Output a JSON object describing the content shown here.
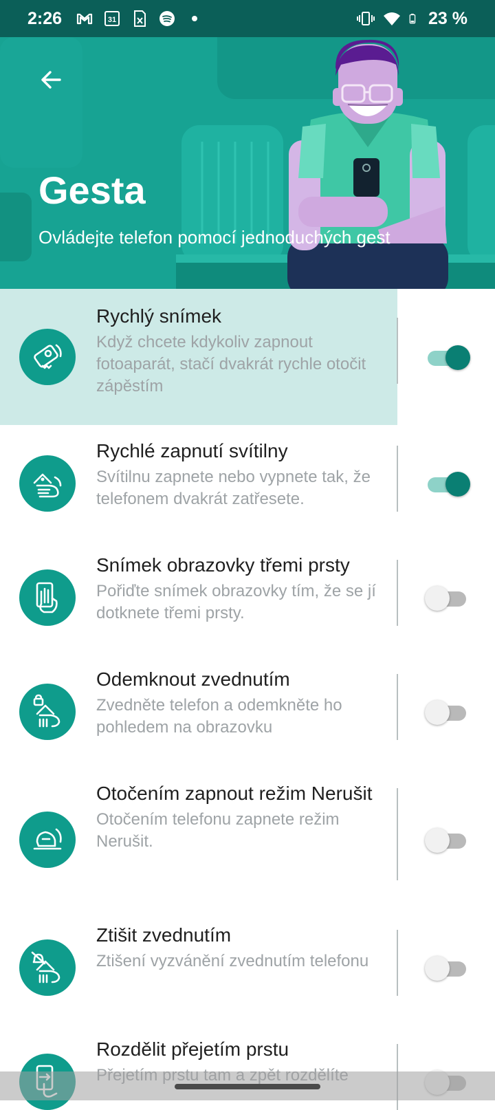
{
  "status_bar": {
    "time": "2:26",
    "battery_text": "23 %",
    "left_icons": [
      "gmail-icon",
      "calendar-icon",
      "sheet-icon",
      "spotify-icon",
      "dot-icon"
    ],
    "right_icons": [
      "vibrate-icon",
      "wifi-icon",
      "battery-icon"
    ],
    "calendar_day": "31"
  },
  "header": {
    "title": "Gesta",
    "subtitle": "Ovládejte telefon pomocí jednoduchých gest",
    "back_icon": "arrow-back-icon"
  },
  "colors": {
    "accent": "#0a7f73",
    "header_bg": "#17a393",
    "status_bg": "#0b5f58",
    "highlight": "#cdeae7"
  },
  "items": [
    {
      "title": "Rychlý snímek",
      "description": "Když chcete kdykoliv zapnout fotoaparát, stačí dvakrát rychle otočit zápěstím",
      "enabled": true,
      "icon": "camera-twist-icon"
    },
    {
      "title": "Rychlé zapnutí svítilny",
      "description": "Svítilnu zapnete nebo vypnete tak, že telefonem dvakrát zatřesete.",
      "enabled": true,
      "icon": "flashlight-chop-icon"
    },
    {
      "title": "Snímek obrazovky třemi prsty",
      "description": "Pořiďte snímek obrazovky tím, že se jí dotknete třemi prsty.",
      "enabled": false,
      "icon": "three-finger-icon"
    },
    {
      "title": "Odemknout zvednutím",
      "description": "Zvedněte telefon a odemkněte ho pohledem na obrazovku",
      "enabled": false,
      "icon": "lift-unlock-icon"
    },
    {
      "title": "Otočením zapnout režim Nerušit",
      "description": "Otočením telefonu zapnete režim Nerušit.",
      "enabled": false,
      "icon": "flip-dnd-icon"
    },
    {
      "title": "Ztišit zvednutím",
      "description": "Ztišení vyzvánění zvednutím telefonu",
      "enabled": false,
      "icon": "lift-silence-icon"
    },
    {
      "title": "Rozdělit přejetím prstu",
      "description": "Přejetím prstu tam a zpět rozdělíte",
      "enabled": false,
      "icon": "swipe-split-icon"
    }
  ]
}
